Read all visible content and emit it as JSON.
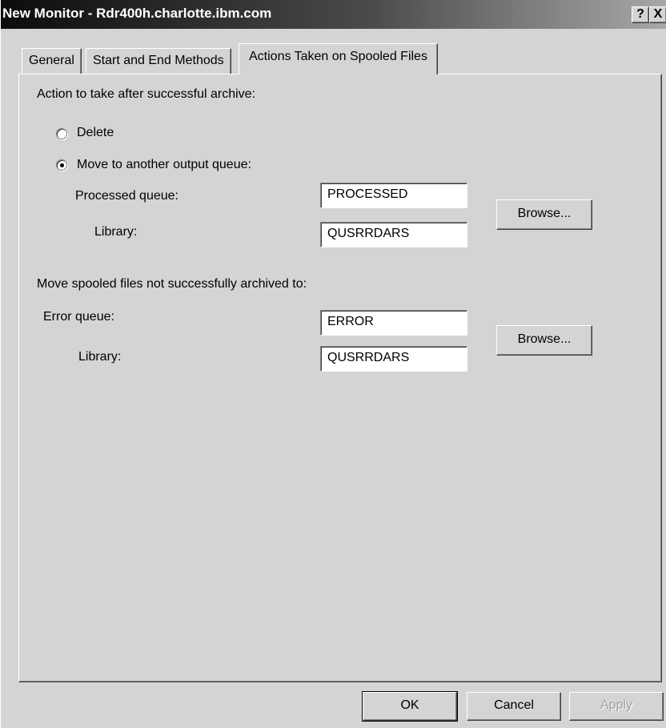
{
  "window": {
    "title": "New Monitor - Rdr400h.charlotte.ibm.com",
    "help_label": "?",
    "close_label": "X"
  },
  "tabs": [
    {
      "label": "General",
      "active": false
    },
    {
      "label": "Start and End Methods",
      "active": false
    },
    {
      "label": "Actions Taken on Spooled Files",
      "active": true
    }
  ],
  "archive_section": {
    "heading": "Action to take after successful archive:",
    "options": [
      {
        "label": "Delete",
        "selected": false
      },
      {
        "label": "Move to another output queue:",
        "selected": true
      }
    ],
    "processed_queue_label": "Processed queue:",
    "processed_queue_value": "PROCESSED",
    "library_label": "Library:",
    "library_value": "QUSRRDARS",
    "browse_label": "Browse..."
  },
  "error_section": {
    "heading": "Move spooled files not successfully archived to:",
    "error_queue_label": "Error queue:",
    "error_queue_value": "ERROR",
    "library_label": "Library:",
    "library_value": "QUSRRDARS",
    "browse_label": "Browse..."
  },
  "footer": {
    "ok_label": "OK",
    "cancel_label": "Cancel",
    "apply_label": "Apply",
    "apply_enabled": false
  }
}
